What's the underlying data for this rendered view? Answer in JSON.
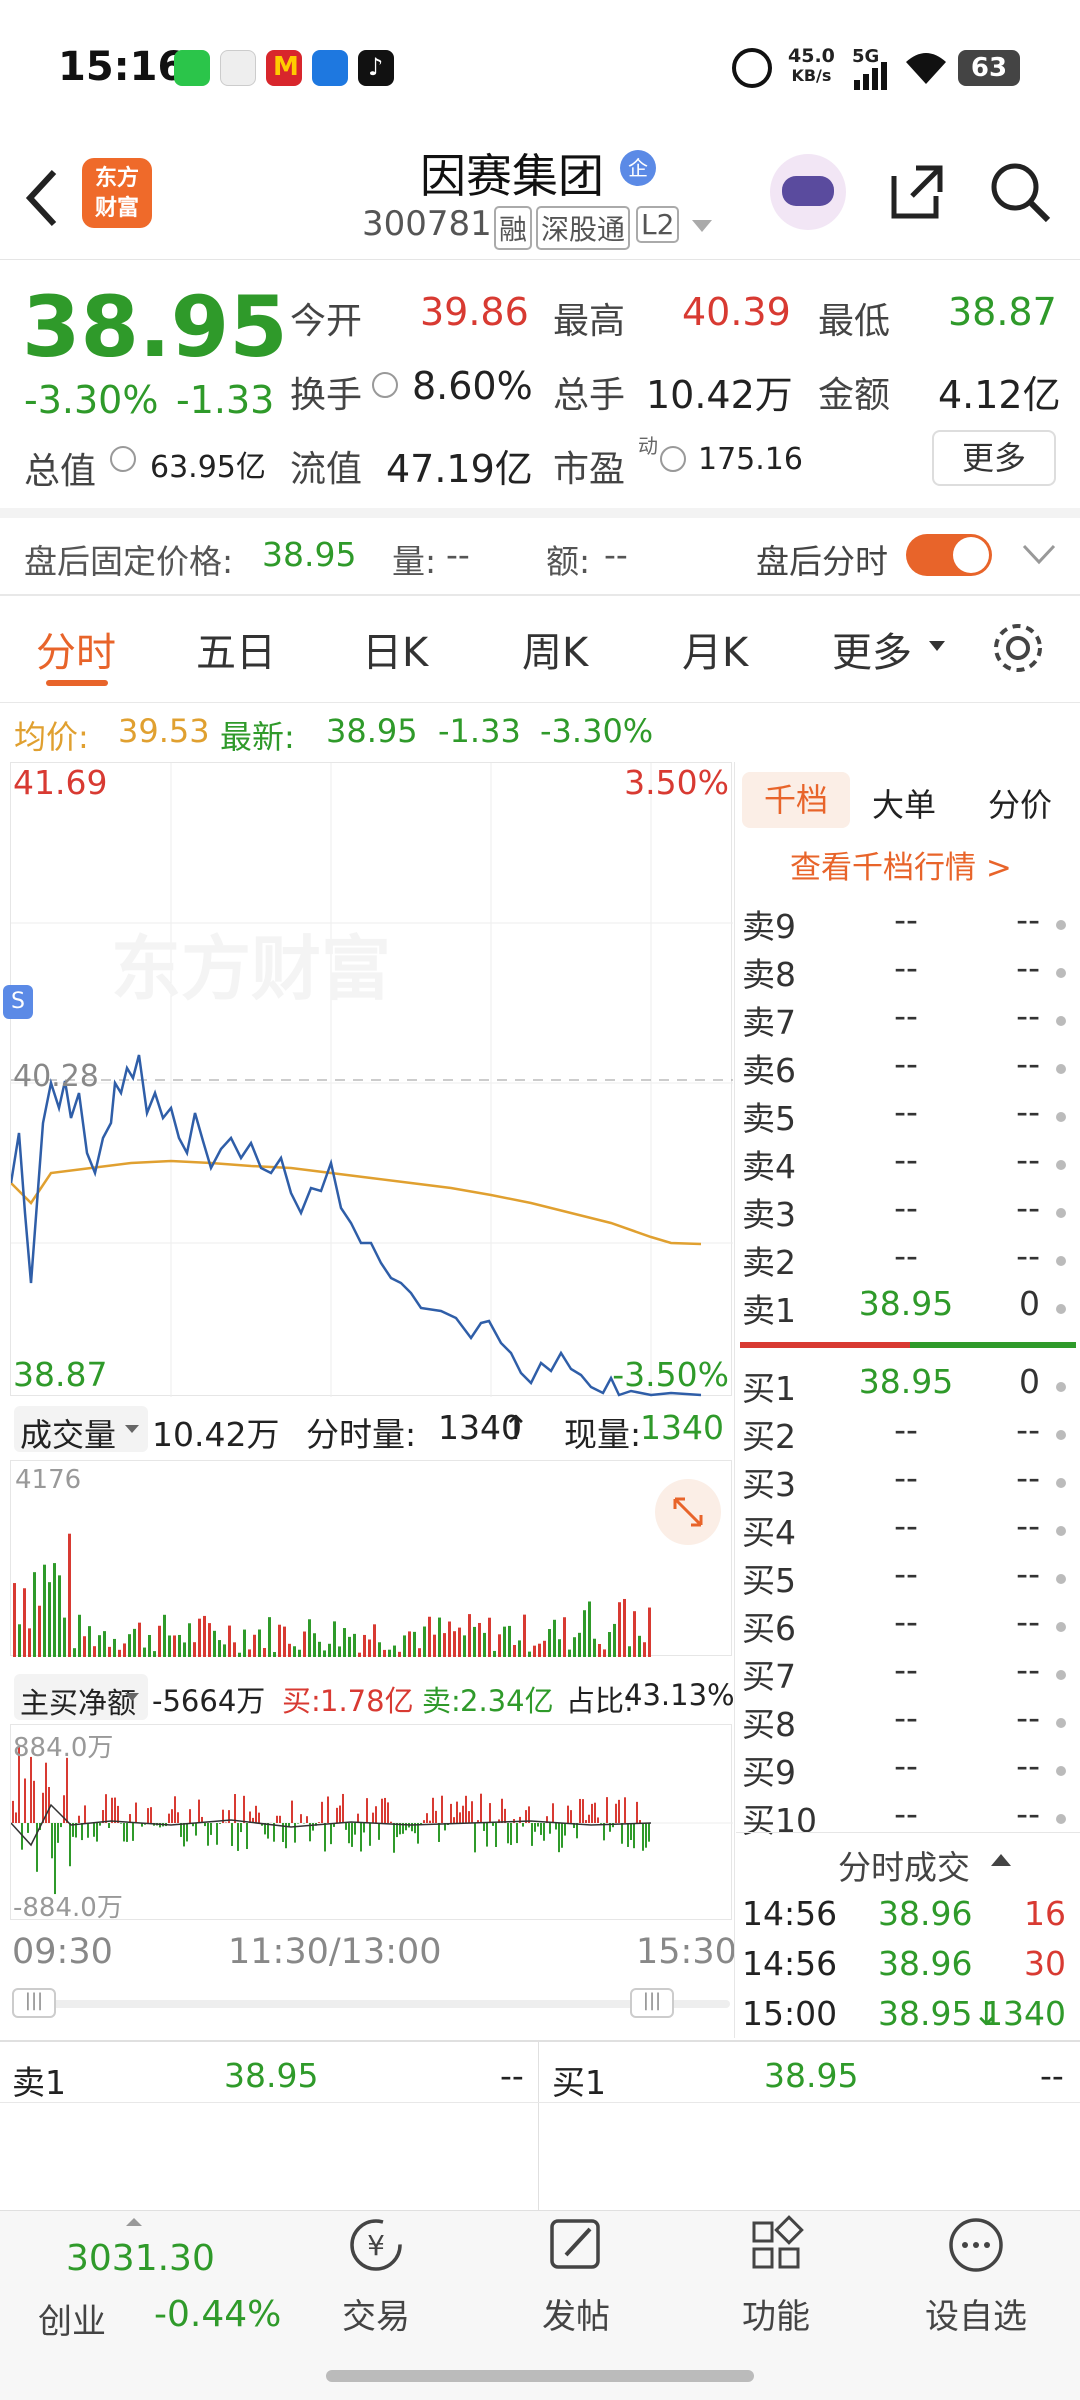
{
  "status_bar": {
    "time": "15:16",
    "net_speed_top": "45.0",
    "net_speed_bottom": "KB/s",
    "signal": "5G",
    "battery": "63"
  },
  "header": {
    "stock_name": "因赛集团",
    "badge": "企",
    "code": "300781",
    "tags": [
      "融",
      "深股通",
      "L2"
    ]
  },
  "quote": {
    "price": "38.95",
    "pct": "-3.30%",
    "chg": "-1.33",
    "today_open_label": "今开",
    "today_open": "39.86",
    "high_label": "最高",
    "high": "40.39",
    "low_label": "最低",
    "low": "38.87",
    "turnover_label": "换手",
    "turnover": "8.60%",
    "volume_label": "总手",
    "volume": "10.42万",
    "amount_label": "金额",
    "amount": "4.12亿",
    "mcap_label": "总值",
    "mcap": "63.95亿",
    "float_label": "流值",
    "float_mcap": "47.19亿",
    "pe_label": "市盈",
    "pe_sup": "动",
    "pe": "175.16",
    "more_button": "更多"
  },
  "afterhours": {
    "fixed_price_label": "盘后固定价格:",
    "fixed_price": "38.95",
    "vol_label": "量:",
    "vol": "--",
    "amt_label": "额:",
    "amt": "--",
    "toggle_label": "盘后分时"
  },
  "tabs": [
    "分时",
    "五日",
    "日K",
    "周K",
    "月K",
    "更多"
  ],
  "avg_line": {
    "avg_label": "均价:",
    "avg": "39.53",
    "last_label": "最新:",
    "last": "38.95",
    "chg": "-1.33",
    "pct": "-3.30%"
  },
  "chart": {
    "top_price": "41.69",
    "top_pct": "3.50%",
    "bottom_price": "38.87",
    "bottom_pct": "-3.50%",
    "ref_price": "40.28",
    "watermark": "东方财富",
    "x_labels": [
      "09:30",
      "11:30/13:00",
      "15:30"
    ]
  },
  "volume_bar": {
    "selector": "成交量",
    "total": "10.42万",
    "tick_label": "分时量:",
    "tick": "1340",
    "tick_arrow": "↑",
    "now_label": "现量:",
    "now": "1340",
    "max": "4176"
  },
  "netbuy_bar": {
    "selector": "主买净额",
    "net": "-5664万",
    "buy_label": "买:",
    "buy": "1.78亿",
    "sell_label": "卖:",
    "sell": "2.34亿",
    "ratio_label": "占比:",
    "ratio": "43.13%",
    "max": "884.0万",
    "min": "-884.0万"
  },
  "orderbook": {
    "tabs": [
      "千档",
      "大单",
      "分价"
    ],
    "link": "查看千档行情 >",
    "asks": [
      {
        "label": "卖9",
        "price": "--",
        "qty": "--"
      },
      {
        "label": "卖8",
        "price": "--",
        "qty": "--"
      },
      {
        "label": "卖7",
        "price": "--",
        "qty": "--"
      },
      {
        "label": "卖6",
        "price": "--",
        "qty": "--"
      },
      {
        "label": "卖5",
        "price": "--",
        "qty": "--"
      },
      {
        "label": "卖4",
        "price": "--",
        "qty": "--"
      },
      {
        "label": "卖3",
        "price": "--",
        "qty": "--"
      },
      {
        "label": "卖2",
        "price": "--",
        "qty": "--"
      },
      {
        "label": "卖1",
        "price": "38.95",
        "qty": "0"
      }
    ],
    "bids": [
      {
        "label": "买1",
        "price": "38.95",
        "qty": "0"
      },
      {
        "label": "买2",
        "price": "--",
        "qty": "--"
      },
      {
        "label": "买3",
        "price": "--",
        "qty": "--"
      },
      {
        "label": "买4",
        "price": "--",
        "qty": "--"
      },
      {
        "label": "买5",
        "price": "--",
        "qty": "--"
      },
      {
        "label": "买6",
        "price": "--",
        "qty": "--"
      },
      {
        "label": "买7",
        "price": "--",
        "qty": "--"
      },
      {
        "label": "买8",
        "price": "--",
        "qty": "--"
      },
      {
        "label": "买9",
        "price": "--",
        "qty": "--"
      },
      {
        "label": "买10",
        "price": "--",
        "qty": "--"
      }
    ],
    "trades_title": "分时成交",
    "trades": [
      {
        "time": "14:56",
        "price": "38.96",
        "qty": "16"
      },
      {
        "time": "14:56",
        "price": "38.96",
        "qty": "30"
      },
      {
        "time": "15:00",
        "price": "38.95↓",
        "qty": "1340"
      }
    ]
  },
  "level_strip": {
    "left_label": "卖1",
    "left_price": "38.95",
    "left_qty": "--",
    "right_label": "买1",
    "right_price": "38.95",
    "right_qty": "--"
  },
  "bottom_nav": {
    "index_value": "3031.30",
    "index_name": "创业",
    "index_pct": "-0.44%",
    "items": [
      "交易",
      "发帖",
      "功能",
      "设自选"
    ]
  },
  "colors": {
    "up": "#d83a32",
    "down": "#2f9a2a",
    "avg": "#e0a030",
    "price_line": "#2f5ea8",
    "accent": "#e8642a"
  }
}
